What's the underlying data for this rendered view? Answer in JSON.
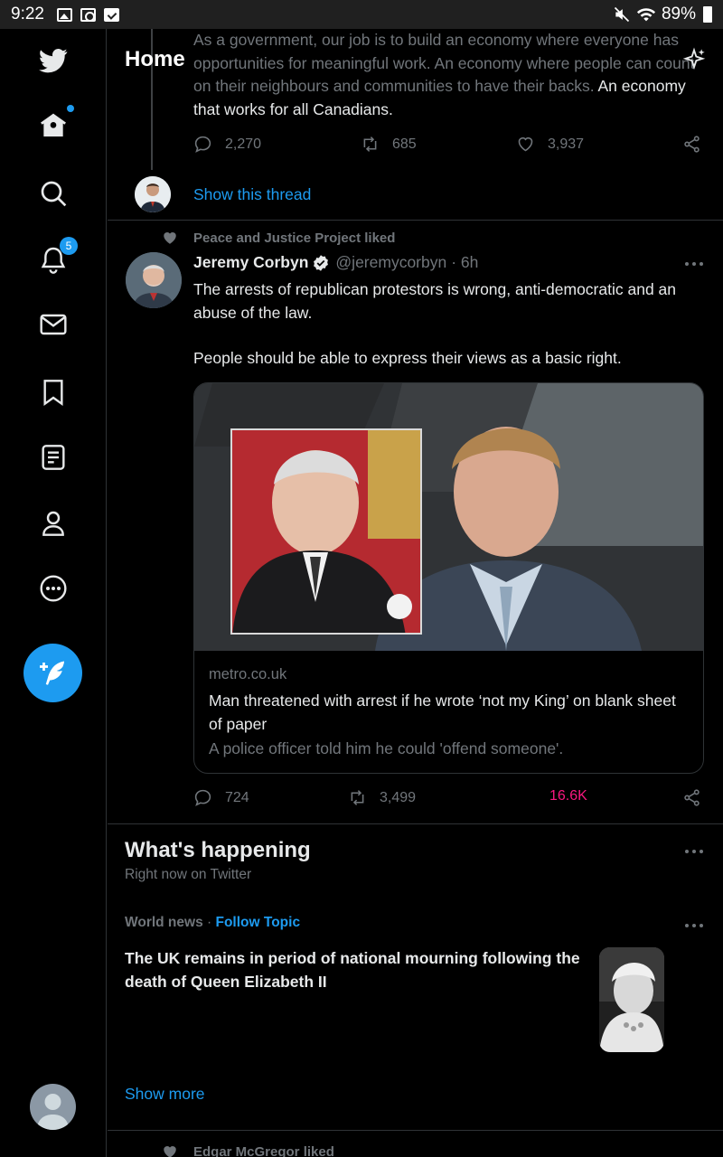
{
  "status_bar": {
    "time": "9:22",
    "battery": "89%",
    "icons": [
      "gallery-icon",
      "cast-icon",
      "check-icon",
      "mute-icon",
      "wifi-icon",
      "battery-icon"
    ]
  },
  "sidebar": {
    "items": [
      {
        "name": "twitter-logo-icon"
      },
      {
        "name": "home-icon"
      },
      {
        "name": "search-icon"
      },
      {
        "name": "notifications-icon",
        "badge": "5"
      },
      {
        "name": "messages-icon"
      },
      {
        "name": "bookmarks-icon"
      },
      {
        "name": "lists-icon"
      },
      {
        "name": "profile-icon"
      },
      {
        "name": "more-icon"
      }
    ],
    "compose_icon": "compose-feather-icon"
  },
  "header": {
    "title": "Home",
    "sparkle_icon": "sparkle-icon"
  },
  "previous_tweet": {
    "text_faded": "As a government, our job is to build an economy where everyone has opportunities for meaningful work. An economy where people can count on their neighbours and communities to have their backs.",
    "text_visible": "An economy that works for all Canadians.",
    "replies": "2,270",
    "retweets": "685",
    "likes": "3,937",
    "show_thread": "Show this thread"
  },
  "tweet": {
    "liked_by": "Peace and Justice Project liked",
    "author_name": "Jeremy Corbyn",
    "handle": "@jeremycorbyn",
    "time": "· 6h",
    "body_line1": "The arrests of republican protestors is wrong, anti-democratic and an abuse of the law.",
    "body_line2": "People should be able to express their views as a basic right.",
    "card": {
      "domain": "metro.co.uk",
      "title": "Man threatened with arrest if he wrote ‘not my King’ on blank sheet of paper",
      "description": "A police officer told him he could 'offend someone'."
    },
    "replies": "724",
    "retweets": "3,499",
    "likes": "16.6K",
    "likes_color": "#f91880"
  },
  "whats_happening": {
    "title": "What's happening",
    "subtitle": "Right now on Twitter",
    "trend": {
      "category": "World news",
      "separator": "·",
      "follow": "Follow Topic",
      "title": "The UK remains in period of national mourning following the death of Queen Elizabeth II"
    },
    "show_more": "Show more"
  },
  "next_tweet": {
    "liked_by": "Edgar McGregor liked"
  },
  "colors": {
    "accent": "#1d9bf0",
    "background": "#000000",
    "divider": "#2f3336",
    "muted": "#71767b",
    "like": "#f91880"
  }
}
